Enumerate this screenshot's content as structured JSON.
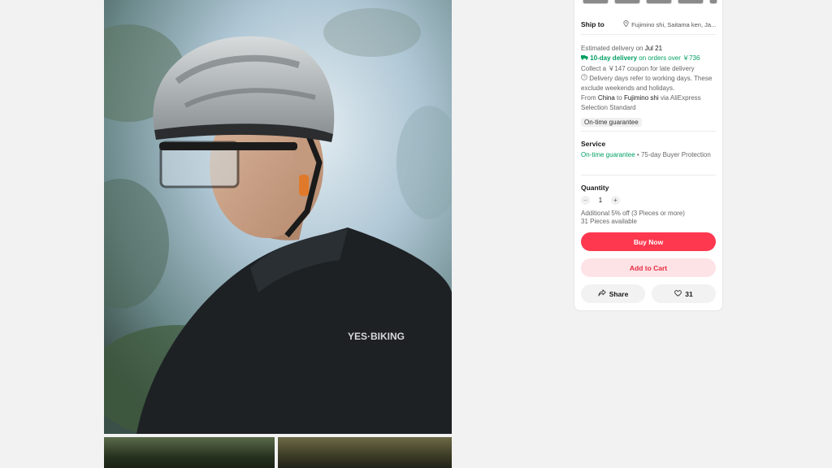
{
  "product": {
    "colors": {
      "accent": "#fd384f",
      "accent_soft": "#fde3e6",
      "green": "#00a062"
    }
  },
  "shipping": {
    "label": "Ship to",
    "location": "Fujimino shi, Saitama ken, Ja...",
    "estimate_prefix": "Estimated delivery on",
    "estimate_date": "Jul 21",
    "fast_delivery": "10-day delivery",
    "fast_delivery_suffix": "on orders over ￥736",
    "coupon": "Collect a ￥147 coupon for late delivery",
    "working_days_note": "Delivery days refer to working days. These exclude weekends and holidays.",
    "route_from_prefix": "From",
    "route_from": "China",
    "route_to_prefix": "to",
    "route_to": "Fujimino shi",
    "route_suffix": "via AliExpress Selection Standard",
    "guarantee_badge": "On-time guarantee"
  },
  "service": {
    "title": "Service",
    "guarantee": "On-time guarantee",
    "protection": " • 75-day Buyer Protection"
  },
  "quantity": {
    "title": "Quantity",
    "minus": "−",
    "value": "1",
    "plus": "+",
    "discount": "Additional 5% off (3 Pieces or more)",
    "available": "31 Pieces available"
  },
  "actions": {
    "buy_now": "Buy Now",
    "add_to_cart": "Add to Cart",
    "share": "Share",
    "wishlist_count": "31"
  },
  "icons": {
    "pin": "location-pin-icon",
    "truck": "truck-icon",
    "info": "info-circle-icon",
    "share": "share-icon",
    "heart": "heart-icon"
  }
}
